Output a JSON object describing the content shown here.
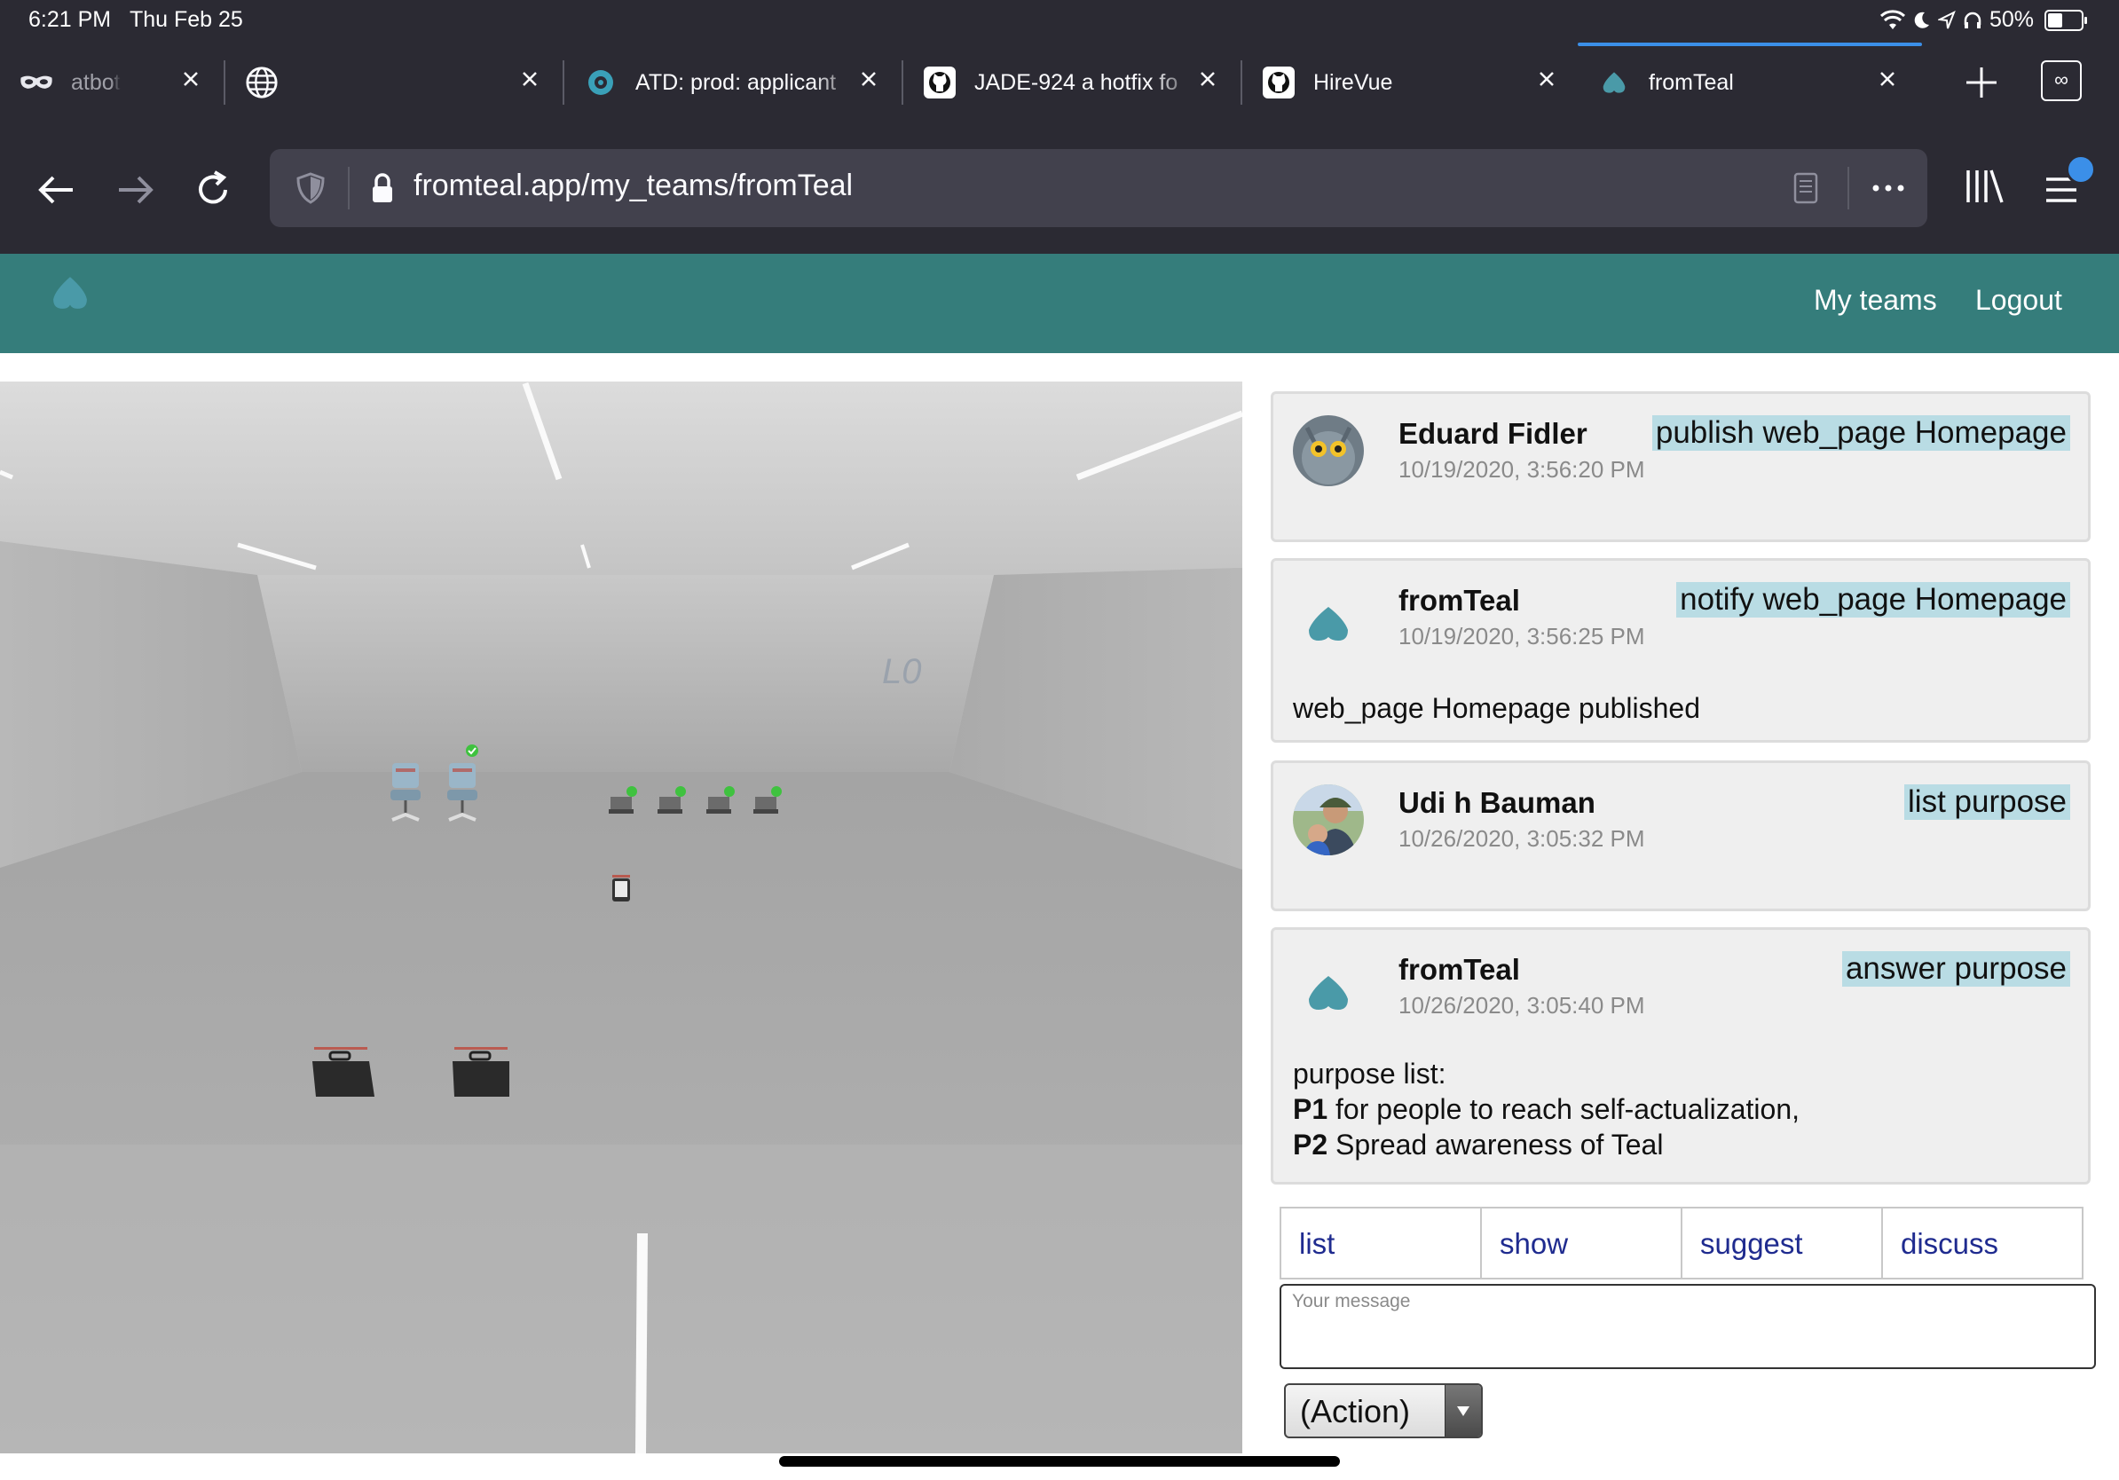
{
  "status_bar": {
    "time": "6:21 PM",
    "date": "Thu Feb 25",
    "battery": "50%"
  },
  "tabs": [
    {
      "title": "atbot.a",
      "icon": "mask-icon"
    },
    {
      "title": "",
      "icon": "globe-icon"
    },
    {
      "title": "ATD: prod: applicant",
      "icon": "eye-icon"
    },
    {
      "title": "JADE-924 a hotfix fo",
      "icon": "github-icon"
    },
    {
      "title": "HireVue",
      "icon": "github-icon"
    },
    {
      "title": "fromTeal",
      "icon": "teal-heart-icon",
      "active": true
    }
  ],
  "address_bar": {
    "url": "fromteal.app/my_teams/fromTeal"
  },
  "app_header": {
    "nav": [
      "My teams",
      "Logout"
    ],
    "brand_color": "#357d7b"
  },
  "scene": {
    "wall_label": "L0"
  },
  "messages": [
    {
      "author": "Eduard Fidler",
      "time": "10/19/2020, 3:56:20 PM",
      "action": "publish web_page Homepage",
      "avatar": "cat-photo"
    },
    {
      "author": "fromTeal",
      "time": "10/19/2020, 3:56:25 PM",
      "action": "notify web_page Homepage",
      "avatar": "teal-heart",
      "body": "web_page Homepage published"
    },
    {
      "author": "Udi h Bauman",
      "time": "10/26/2020, 3:05:32 PM",
      "action": "list purpose",
      "avatar": "user-photo"
    },
    {
      "author": "fromTeal",
      "time": "10/26/2020, 3:05:40 PM",
      "action": "answer purpose",
      "avatar": "teal-heart",
      "body_intro": "purpose list:",
      "purposes": [
        {
          "id": "P1",
          "text": "for people to reach self-actualization,"
        },
        {
          "id": "P2",
          "text": "Spread awareness of Teal"
        }
      ]
    }
  ],
  "composer": {
    "commands": [
      "list",
      "show",
      "suggest",
      "discuss"
    ],
    "placeholder": "Your message",
    "action_select": "(Action)"
  },
  "colors": {
    "action_highlight": "#b9dce4",
    "command_text": "#1f2b8f",
    "teal": "#4a9aa8"
  }
}
